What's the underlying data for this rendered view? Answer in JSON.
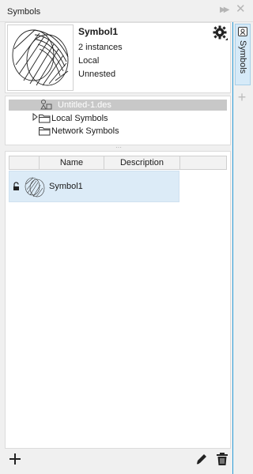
{
  "panel": {
    "title": "Symbols",
    "side_tab_label": "Symbols",
    "accent_color": "#2a9bd7"
  },
  "preview": {
    "name": "Symbol1",
    "instances": "2 instances",
    "scope": "Local",
    "nesting": "Unnested"
  },
  "tree": {
    "items": [
      {
        "label": "Untitled-1.des",
        "icon": "document-symbols-icon",
        "selected": true
      },
      {
        "label": "Local Symbols",
        "icon": "folder-icon",
        "expandable": true
      },
      {
        "label": "Network Symbols",
        "icon": "folder-icon"
      }
    ]
  },
  "list": {
    "columns": [
      "Name",
      "Description"
    ],
    "rows": [
      {
        "name": "Symbol1",
        "description": "",
        "locked": true
      }
    ]
  },
  "icons": {
    "expand": "fast-forward-icon",
    "close": "close-icon",
    "gear": "gear-icon",
    "add": "plus-icon",
    "edit": "pencil-icon",
    "delete": "trash-icon"
  }
}
